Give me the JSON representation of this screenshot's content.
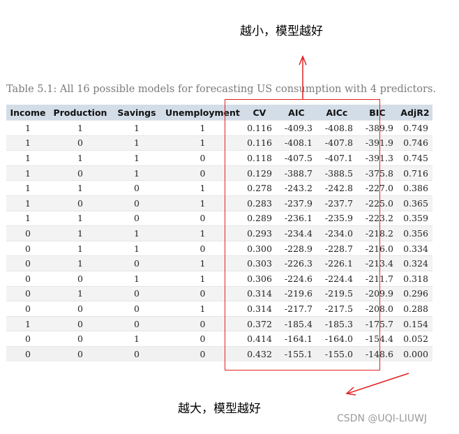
{
  "annotations": {
    "top": "越小，模型越好",
    "bottom": "越大，模型越好",
    "watermark": "CSDN @UQI-LIUWJ",
    "color": "#e02020"
  },
  "caption": "Table 5.1: All 16 possible models for forecasting US consumption with 4 predictors.",
  "table": {
    "headers": [
      "Income",
      "Production",
      "Savings",
      "Unemployment",
      "CV",
      "AIC",
      "AICc",
      "BIC",
      "AdjR2"
    ],
    "rows": [
      [
        "1",
        "1",
        "1",
        "1",
        "0.116",
        "-409.3",
        "-408.8",
        "-389.9",
        "0.749"
      ],
      [
        "1",
        "0",
        "1",
        "1",
        "0.116",
        "-408.1",
        "-407.8",
        "-391.9",
        "0.746"
      ],
      [
        "1",
        "1",
        "1",
        "0",
        "0.118",
        "-407.5",
        "-407.1",
        "-391.3",
        "0.745"
      ],
      [
        "1",
        "0",
        "1",
        "0",
        "0.129",
        "-388.7",
        "-388.5",
        "-375.8",
        "0.716"
      ],
      [
        "1",
        "1",
        "0",
        "1",
        "0.278",
        "-243.2",
        "-242.8",
        "-227.0",
        "0.386"
      ],
      [
        "1",
        "0",
        "0",
        "1",
        "0.283",
        "-237.9",
        "-237.7",
        "-225.0",
        "0.365"
      ],
      [
        "1",
        "1",
        "0",
        "0",
        "0.289",
        "-236.1",
        "-235.9",
        "-223.2",
        "0.359"
      ],
      [
        "0",
        "1",
        "1",
        "1",
        "0.293",
        "-234.4",
        "-234.0",
        "-218.2",
        "0.356"
      ],
      [
        "0",
        "1",
        "1",
        "0",
        "0.300",
        "-228.9",
        "-228.7",
        "-216.0",
        "0.334"
      ],
      [
        "0",
        "1",
        "0",
        "1",
        "0.303",
        "-226.3",
        "-226.1",
        "-213.4",
        "0.324"
      ],
      [
        "0",
        "0",
        "1",
        "1",
        "0.306",
        "-224.6",
        "-224.4",
        "-211.7",
        "0.318"
      ],
      [
        "0",
        "1",
        "0",
        "0",
        "0.314",
        "-219.6",
        "-219.5",
        "-209.9",
        "0.296"
      ],
      [
        "0",
        "0",
        "0",
        "1",
        "0.314",
        "-217.7",
        "-217.5",
        "-208.0",
        "0.288"
      ],
      [
        "1",
        "0",
        "0",
        "0",
        "0.372",
        "-185.4",
        "-185.3",
        "-175.7",
        "0.154"
      ],
      [
        "0",
        "0",
        "1",
        "0",
        "0.414",
        "-164.1",
        "-164.0",
        "-154.4",
        "0.052"
      ],
      [
        "0",
        "0",
        "0",
        "0",
        "0.432",
        "-155.1",
        "-155.0",
        "-148.6",
        "0.000"
      ]
    ]
  }
}
